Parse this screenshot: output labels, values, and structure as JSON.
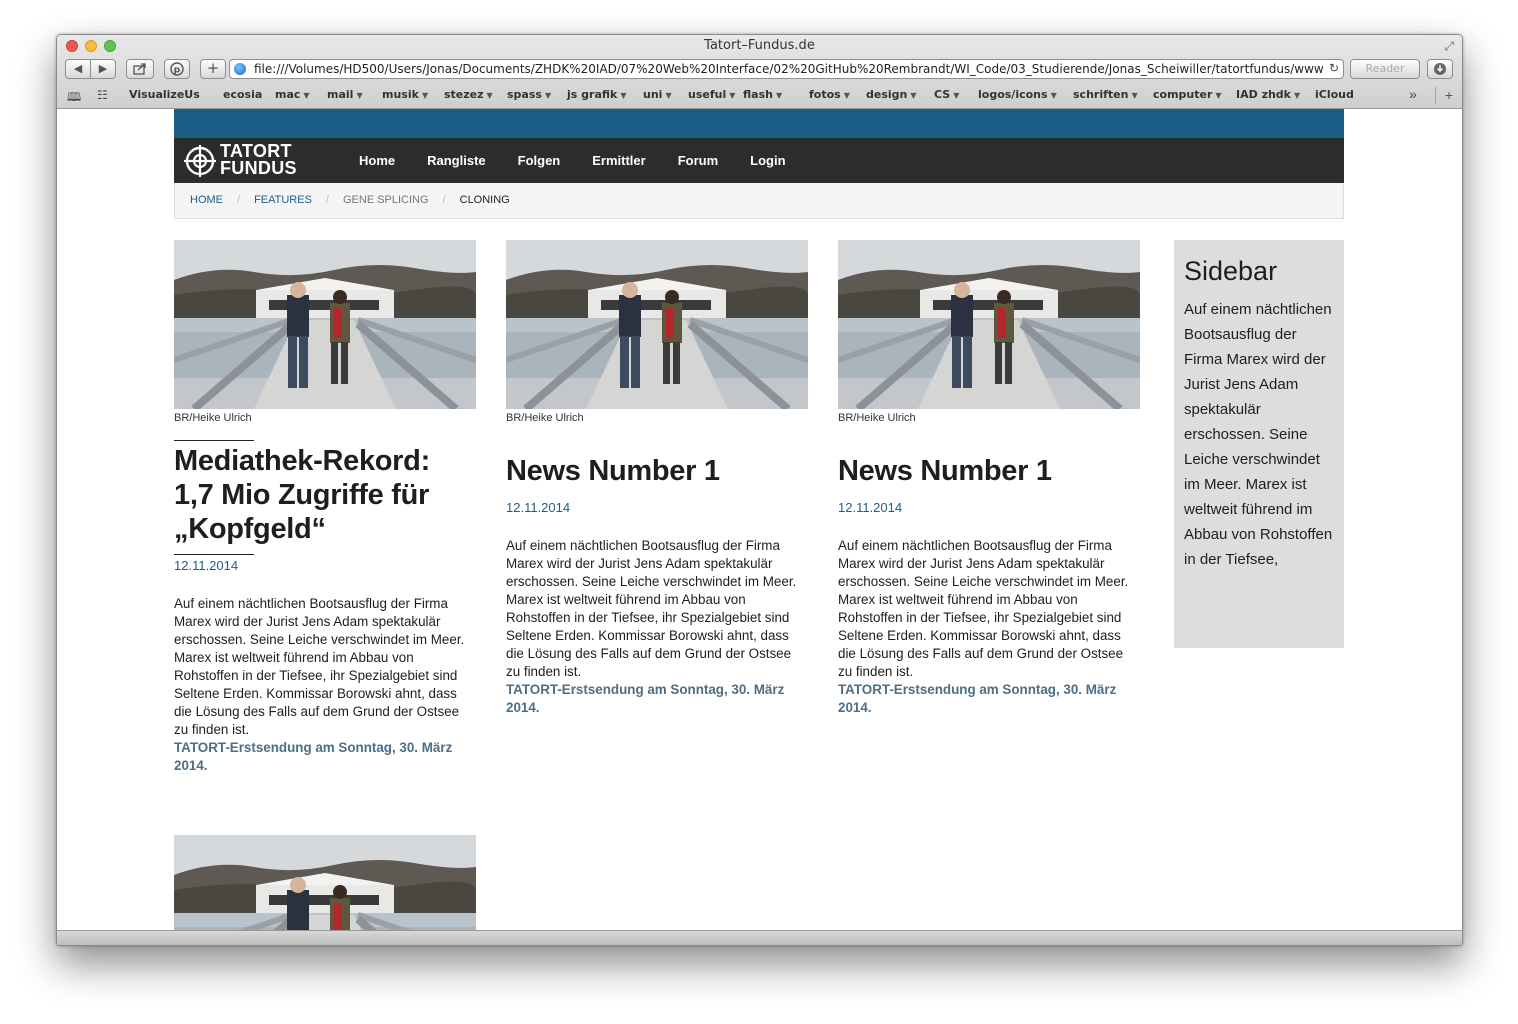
{
  "browser": {
    "window_title": "Tatort–Fundus.de",
    "url": "file:///Volumes/HD500/Users/Jonas/Documents/ZHDK%20IAD/07%20Web%20Interface/02%20GitHub%20Rembrandt/WI_Code/03_Studierende/Jonas_Scheiwiller/tatortfundus/www/fo",
    "reader_label": "Reader",
    "bookmarks": [
      {
        "label": "VisualizeUs",
        "menu": false
      },
      {
        "label": "ecosia",
        "menu": false
      },
      {
        "label": "mac",
        "menu": true
      },
      {
        "label": "mail",
        "menu": true
      },
      {
        "label": "musik",
        "menu": true
      },
      {
        "label": "stezez",
        "menu": true
      },
      {
        "label": "spass",
        "menu": true
      },
      {
        "label": "js grafik",
        "menu": true
      },
      {
        "label": "uni",
        "menu": true
      },
      {
        "label": "useful",
        "menu": true
      },
      {
        "label": "flash",
        "menu": true
      },
      {
        "label": "fotos",
        "menu": true
      },
      {
        "label": "design",
        "menu": true
      },
      {
        "label": "CS",
        "menu": true
      },
      {
        "label": "logos/icons",
        "menu": true
      },
      {
        "label": "schriften",
        "menu": true
      },
      {
        "label": "computer",
        "menu": true
      },
      {
        "label": "IAD zhdk",
        "menu": true
      },
      {
        "label": "iCloud",
        "menu": false
      }
    ]
  },
  "site": {
    "logo_line1": "TATORT",
    "logo_line2": "FUNDUS",
    "nav": [
      "Home",
      "Rangliste",
      "Folgen",
      "Ermittler",
      "Forum",
      "Login"
    ],
    "breadcrumb": [
      {
        "label": "Home",
        "state": "link"
      },
      {
        "label": "Features",
        "state": "link"
      },
      {
        "label": "Gene Splicing",
        "state": "muted"
      },
      {
        "label": "Cloning",
        "state": "current"
      }
    ],
    "articles": [
      {
        "caption": "BR/Heike Ulrich",
        "title": "Mediathek-Rekord: 1,7 Mio Zugriffe für „Kopfgeld“",
        "date": "12.11.2014",
        "body": "Auf einem nächtlichen Bootsausflug der Firma Marex wird der Jurist Jens Adam spektakulär erschossen. Seine Leiche verschwindet im Meer. Marex ist weltweit führend im Abbau von Rohstoffen in der Tiefsee, ihr Spezialgebiet sind Seltene Erden. Kommissar Borowski ahnt, dass die Lösung des Falls auf dem Grund der Ostsee zu finden ist.",
        "teaser": "TATORT-Erstsendung am Sonntag, 30. März 2014."
      },
      {
        "caption": "BR/Heike Ulrich",
        "title": "News Number 1",
        "date": "12.11.2014",
        "body": "Auf einem nächtlichen Bootsausflug der Firma Marex wird der Jurist Jens Adam spektakulär erschossen. Seine Leiche verschwindet im Meer. Marex ist weltweit führend im Abbau von Rohstoffen in der Tiefsee, ihr Spezialgebiet sind Seltene Erden. Kommissar Borowski ahnt, dass die Lösung des Falls auf dem Grund der Ostsee zu finden ist.",
        "teaser": "TATORT-Erstsendung am Sonntag, 30. März 2014."
      },
      {
        "caption": "BR/Heike Ulrich",
        "title": "News Number 1",
        "date": "12.11.2014",
        "body": "Auf einem nächtlichen Bootsausflug der Firma Marex wird der Jurist Jens Adam spektakulär erschossen. Seine Leiche verschwindet im Meer. Marex ist weltweit führend im Abbau von Rohstoffen in der Tiefsee, ihr Spezialgebiet sind Seltene Erden. Kommissar Borowski ahnt, dass die Lösung des Falls auf dem Grund der Ostsee zu finden ist.",
        "teaser": "TATORT-Erstsendung am Sonntag, 30. März 2014."
      }
    ],
    "sidebar": {
      "title": "Sidebar",
      "text": "Auf einem nächtlichen Bootsausflug der Firma Marex wird der Jurist Jens Adam spektakulär erschossen. Seine Leiche verschwindet im Meer. Marex ist weltweit führend im Abbau von Rohstoffen in der Tiefsee,"
    },
    "colors": {
      "brand_blue": "#1c5e86",
      "navbar_dark": "#2c2c2c",
      "teaser_blue": "#4c6e86",
      "sidebar_grey": "#dddddd"
    }
  }
}
